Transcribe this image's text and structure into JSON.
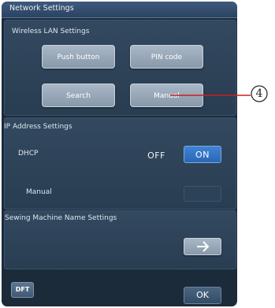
{
  "window": {
    "title": "Network Settings"
  },
  "wireless": {
    "section_label": "Wireless LAN Settings",
    "push_button_label": "Push button",
    "pin_code_label": "PIN code",
    "search_label": "Search",
    "manual_label": "Manual"
  },
  "ip": {
    "section_label": "IP Address Settings",
    "dhcp_label": "DHCP",
    "off_label": "OFF",
    "on_label": "ON",
    "selected": "ON",
    "manual_label": "Manual"
  },
  "machine_name": {
    "section_label": "Sewing Machine Name Settings",
    "arrow_icon": "right-arrow-icon"
  },
  "footer": {
    "dft_label": "DFT",
    "ok_label": "OK"
  },
  "callout": {
    "number": "4",
    "line_color": "#cc1f1f"
  },
  "colors": {
    "background": "#1c2b3a",
    "titlebar": "#3e5a7c",
    "panel": "#33495f",
    "button": "#9aa9ba",
    "toggle_on": "#3377c8"
  }
}
